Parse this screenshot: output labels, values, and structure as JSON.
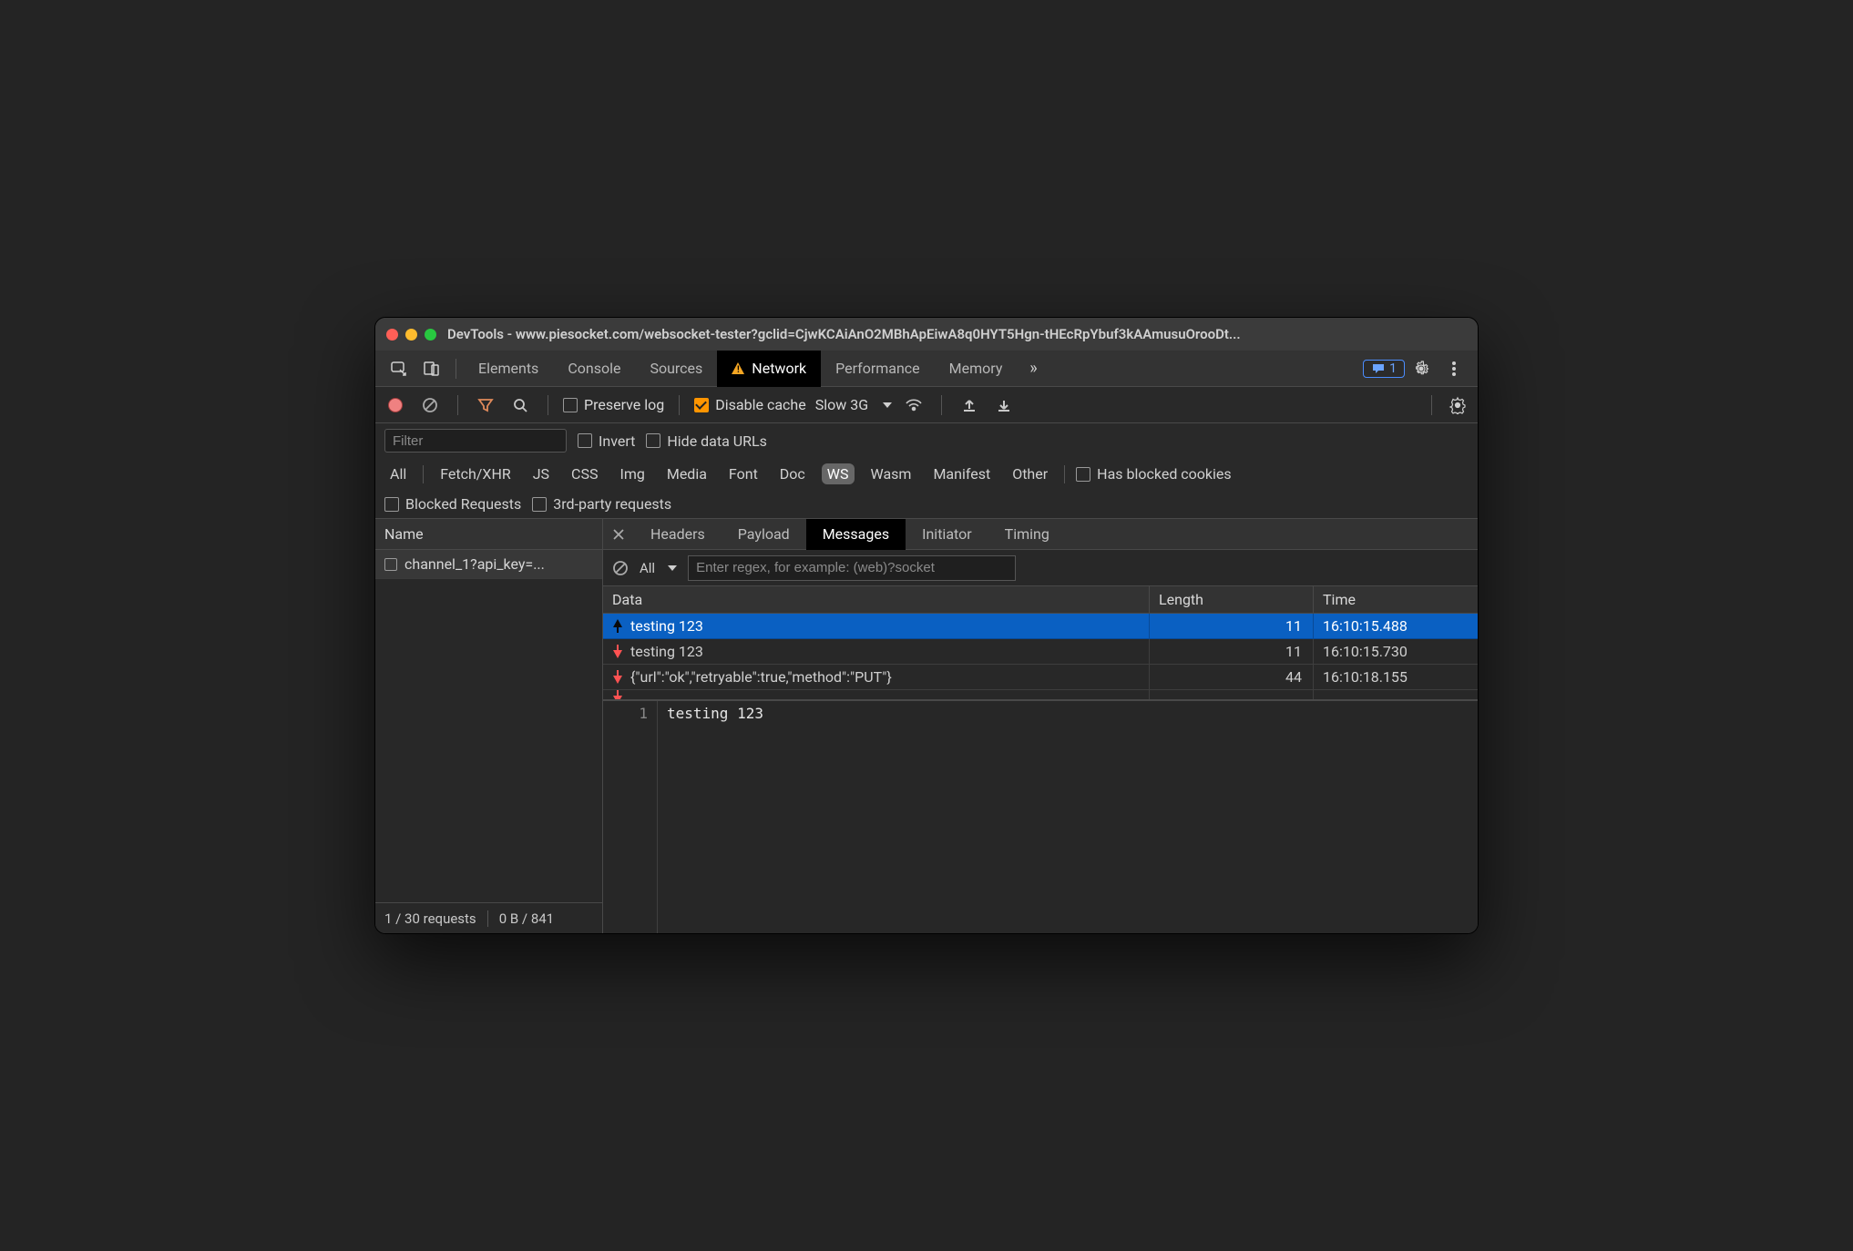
{
  "window": {
    "title": "DevTools - www.piesocket.com/websocket-tester?gclid=CjwKCAiAnO2MBhApEiwA8q0HYT5Hgn-tHEcRpYbuf3kAAmusuOrooDt..."
  },
  "tabs": {
    "items": [
      "Elements",
      "Console",
      "Sources",
      "Network",
      "Performance",
      "Memory"
    ],
    "active": "Network",
    "overflow": "»",
    "issues_count": "1"
  },
  "actionbar": {
    "preserve_log_label": "Preserve log",
    "disable_cache_label": "Disable cache",
    "throttle": "Slow 3G"
  },
  "filters": {
    "filter_placeholder": "Filter",
    "invert_label": "Invert",
    "hide_data_urls_label": "Hide data URLs",
    "types": [
      "All",
      "Fetch/XHR",
      "JS",
      "CSS",
      "Img",
      "Media",
      "Font",
      "Doc",
      "WS",
      "Wasm",
      "Manifest",
      "Other"
    ],
    "selected_type": "WS",
    "has_blocked_cookies_label": "Has blocked cookies",
    "blocked_requests_label": "Blocked Requests",
    "third_party_label": "3rd-party requests"
  },
  "requests": {
    "name_header": "Name",
    "items": [
      {
        "label": "channel_1?api_key=..."
      }
    ],
    "status_left": "1 / 30 requests",
    "status_right": "0 B / 841"
  },
  "detail": {
    "tabs": [
      "Headers",
      "Payload",
      "Messages",
      "Initiator",
      "Timing"
    ],
    "active": "Messages",
    "filter_all": "All",
    "regex_placeholder": "Enter regex, for example: (web)?socket",
    "columns": {
      "data": "Data",
      "length": "Length",
      "time": "Time"
    },
    "messages": [
      {
        "dir": "up",
        "text": "testing 123",
        "length": "11",
        "time": "16:10:15.488",
        "selected": true
      },
      {
        "dir": "down",
        "text": "testing 123",
        "length": "11",
        "time": "16:10:15.730",
        "selected": false
      },
      {
        "dir": "down",
        "text": "{\"url\":\"ok\",\"retryable\":true,\"method\":\"PUT\"}",
        "length": "44",
        "time": "16:10:18.155",
        "selected": false
      }
    ],
    "preview_line_no": "1",
    "preview_text": "testing 123"
  }
}
